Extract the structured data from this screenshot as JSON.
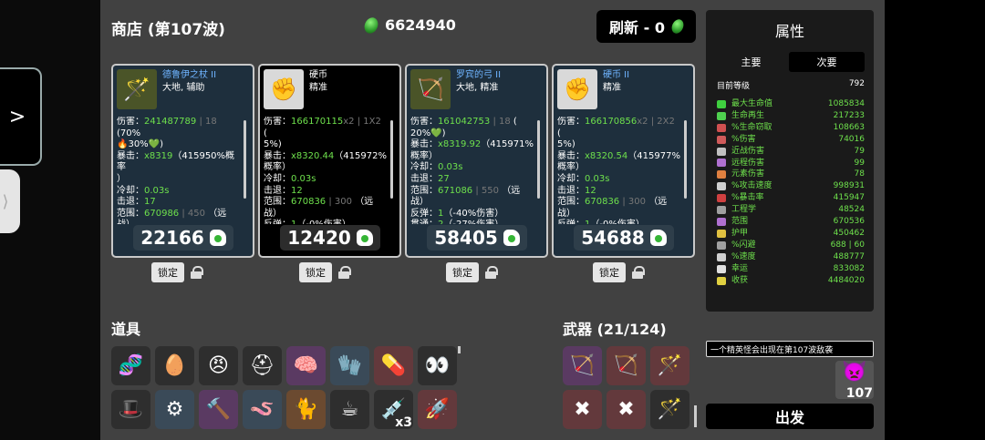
{
  "shop": {
    "title": "商店 (第107波)"
  },
  "currency": {
    "amount": "6624940"
  },
  "refresh": {
    "label": "刷新 - 0"
  },
  "cards": [
    {
      "name": "德鲁伊之杖 II",
      "tags": "大地, 辅助",
      "lines": [
        [
          "伤害：",
          "241487789",
          " | 18 ",
          "(70%"
        ],
        [
          "🔥30%",
          "",
          "",
          "💚)"
        ],
        [
          "暴击：",
          "x8319",
          "",
          "（415950%概率"
        ],
        [
          "）",
          "",
          "",
          ""
        ],
        [
          "冷却：",
          "0.03s",
          "",
          ""
        ],
        [
          "击退：",
          "17",
          "",
          ""
        ],
        [
          "范围：",
          "670986",
          " | 450 ",
          "（远战）"
        ],
        [
          "反弹：",
          "1",
          "",
          "（-50%伤害）"
        ],
        [
          "贯通：",
          "1",
          "",
          "（-0%伤害）"
        ]
      ],
      "price": "22166",
      "lock_label": "锁定",
      "icon": "staff-icon"
    },
    {
      "name": "硬币",
      "tags": "精准",
      "lines": [
        [
          "伤害：",
          "166170115",
          "x2 | 1X2 ",
          "("
        ],
        [
          "5%",
          "",
          "",
          ")"
        ],
        [
          "暴击：",
          "x8320.44",
          "",
          "（415972%"
        ],
        [
          "概率）",
          "",
          "",
          ""
        ],
        [
          "冷却：",
          "0.03s",
          "",
          ""
        ],
        [
          "击退：",
          "12",
          "",
          ""
        ],
        [
          "范围：",
          "670836",
          " | 300 ",
          "（远战）"
        ],
        [
          "反弹：",
          "1",
          "",
          "（-0%伤害）"
        ],
        [
          "贯通：",
          "1",
          "",
          "（-32%伤害）"
        ]
      ],
      "price": "12420",
      "lock_label": "锁定",
      "icon": "fist-icon"
    },
    {
      "name": "罗宾的弓 II",
      "tags": "大地, 精准",
      "lines": [
        [
          "伤害：",
          "161042753",
          " | 18 ",
          "("
        ],
        [
          "20%",
          "",
          "",
          "💚)"
        ],
        [
          "暴击：",
          "x8319.92",
          "",
          "（415971%"
        ],
        [
          "概率）",
          "",
          "",
          ""
        ],
        [
          "冷却：",
          "0.03s",
          "",
          ""
        ],
        [
          "击退：",
          "27",
          "",
          ""
        ],
        [
          "范围：",
          "671086",
          " | 550 ",
          "（远战）"
        ],
        [
          "反弹：",
          "1",
          "",
          "（-40%伤害）"
        ],
        [
          "贯通：",
          "2",
          "",
          "（-27%伤害）"
        ]
      ],
      "price": "58405",
      "lock_label": "锁定",
      "icon": "bow-icon"
    },
    {
      "name": "硬币 II",
      "tags": "精准",
      "lines": [
        [
          "伤害：",
          "166170856",
          "x2 | 2X2 ",
          "("
        ],
        [
          "5%",
          "",
          "",
          ")"
        ],
        [
          "暴击：",
          "x8320.54",
          "",
          "（415977%"
        ],
        [
          "概率）",
          "",
          "",
          ""
        ],
        [
          "冷却：",
          "0.03s",
          "",
          ""
        ],
        [
          "击退：",
          "12",
          "",
          ""
        ],
        [
          "范围：",
          "670836",
          " | 300 ",
          "（远战）"
        ],
        [
          "反弹：",
          "1",
          "",
          "（-0%伤害）"
        ],
        [
          "贯通：",
          "1",
          "",
          "（-32%伤害）"
        ]
      ],
      "price": "54688",
      "lock_label": "锁定",
      "icon": "fist-icon"
    }
  ],
  "items": {
    "title": "道具",
    "slots": [
      {
        "icon": "dna-icon",
        "glyph": "🧬",
        "style": "s-gray",
        "qty": ""
      },
      {
        "icon": "egg-face-icon",
        "glyph": "🥚",
        "style": "s-gray",
        "qty": ""
      },
      {
        "icon": "angry-egg-icon",
        "glyph": "😠",
        "style": "s-gray",
        "qty": ""
      },
      {
        "icon": "helmet-icon",
        "glyph": "⛑",
        "style": "s-gray",
        "qty": ""
      },
      {
        "icon": "brain-icon",
        "glyph": "🧠",
        "style": "s-purple",
        "qty": ""
      },
      {
        "icon": "glove-icon",
        "glyph": "🧤",
        "style": "s-blue",
        "qty": ""
      },
      {
        "icon": "pill-icon",
        "glyph": "💊",
        "style": "s-red",
        "qty": ""
      },
      {
        "icon": "eyes-icon",
        "glyph": "👀",
        "style": "s-gray",
        "qty": ""
      },
      {
        "icon": "hat-icon",
        "glyph": "🎩",
        "style": "s-gray",
        "qty": ""
      },
      {
        "icon": "gear-icon",
        "glyph": "⚙",
        "style": "s-blue",
        "qty": ""
      },
      {
        "icon": "hammer-icon",
        "glyph": "🔨",
        "style": "s-purple",
        "qty": ""
      },
      {
        "icon": "worm-icon",
        "glyph": "🪱",
        "style": "s-blue",
        "qty": ""
      },
      {
        "icon": "cat-icon",
        "glyph": "🐈",
        "style": "s-tan",
        "qty": ""
      },
      {
        "icon": "coffee-icon",
        "glyph": "☕",
        "style": "s-gray",
        "qty": ""
      },
      {
        "icon": "syringe-icon",
        "glyph": "💉",
        "style": "s-gray",
        "qty": "x3"
      },
      {
        "icon": "rocket-icon",
        "glyph": "🚀",
        "style": "s-red",
        "qty": ""
      }
    ]
  },
  "weapons": {
    "title": "武器 (21/124)",
    "slots": [
      {
        "icon": "bow-icon",
        "glyph": "🏹",
        "style": "s-purple"
      },
      {
        "icon": "bow-icon",
        "glyph": "🏹",
        "style": "s-red"
      },
      {
        "icon": "staff-icon",
        "glyph": "🪄",
        "style": "s-red"
      },
      {
        "icon": "crossed-bones-icon",
        "glyph": "✖",
        "style": "s-red"
      },
      {
        "icon": "crossed-bones-icon",
        "glyph": "✖",
        "style": "s-red"
      },
      {
        "icon": "staff-icon",
        "glyph": "🪄",
        "style": "s-gray"
      }
    ]
  },
  "attributes": {
    "title": "属性",
    "tab_primary": "主要",
    "tab_secondary": "次要",
    "level_label": "目前等级",
    "level_value": "792",
    "rows": [
      {
        "name": "最大生命值",
        "value": "1085834",
        "color": "#3fcf3f"
      },
      {
        "name": "生命再生",
        "value": "217233",
        "color": "#4fd04f"
      },
      {
        "name": "%生命窃取",
        "value": "108663",
        "color": "#d05050"
      },
      {
        "name": "%伤害",
        "value": "74016",
        "color": "#d05a5a"
      },
      {
        "name": "近战伤害",
        "value": "79",
        "color": "#c0c0c0"
      },
      {
        "name": "远程伤害",
        "value": "99",
        "color": "#b070d0"
      },
      {
        "name": "元素伤害",
        "value": "78",
        "color": "#e08040"
      },
      {
        "name": "%攻击速度",
        "value": "998931",
        "color": "#d0d0d0"
      },
      {
        "name": "%暴击率",
        "value": "415947",
        "color": "#d04040"
      },
      {
        "name": "工程学",
        "value": "48524",
        "color": "#a0a0a0"
      },
      {
        "name": "范围",
        "value": "670536",
        "color": "#b070d0"
      },
      {
        "name": "护甲",
        "value": "450462",
        "color": "#e0c040"
      },
      {
        "name": "%闪避",
        "value": "688 | 60",
        "color": "#a0a0a0"
      },
      {
        "name": "%速度",
        "value": "488777",
        "color": "#d0d0d0"
      },
      {
        "name": "幸运",
        "value": "833082",
        "color": "#e0e0e0"
      },
      {
        "name": "收获",
        "value": "4484020",
        "color": "#e0d040"
      }
    ]
  },
  "message": "一个精英怪会出现在第107波敌袭",
  "boss": {
    "count": "107"
  },
  "go_label": "出发"
}
